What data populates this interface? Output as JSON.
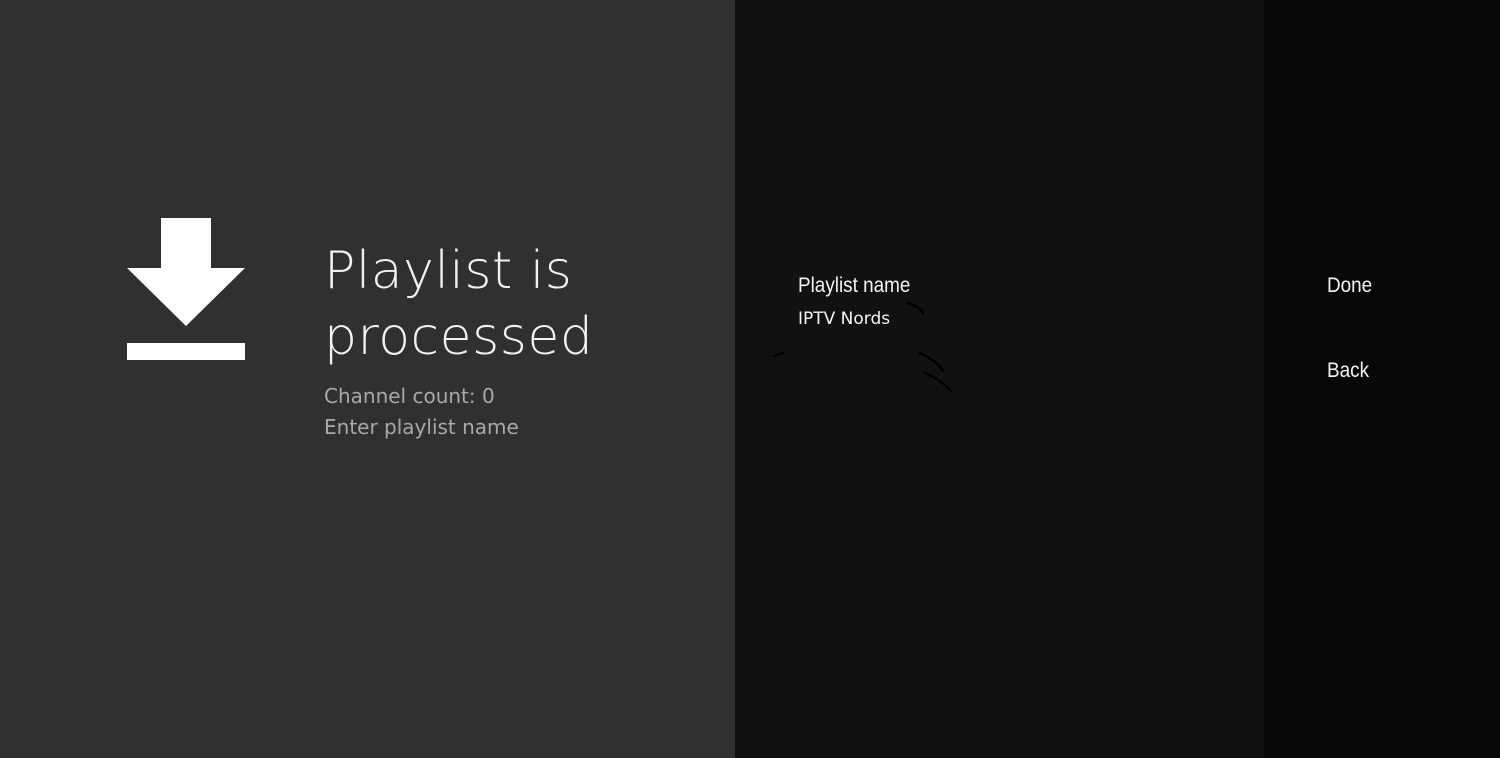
{
  "guidance": {
    "icon": "download-icon",
    "title": "Playlist is processed",
    "channel_count": "Channel count: 0",
    "instruction": "Enter playlist name"
  },
  "form": {
    "label": "Playlist name",
    "value": "IPTV Nords"
  },
  "actions": {
    "done_label": "Done",
    "back_label": "Back"
  },
  "colors": {
    "guidance_bg": "#303030",
    "form_bg": "#111111",
    "actions_bg": "#080808",
    "text_primary": "#f4f4f4",
    "text_secondary": "#a8a8a8"
  }
}
